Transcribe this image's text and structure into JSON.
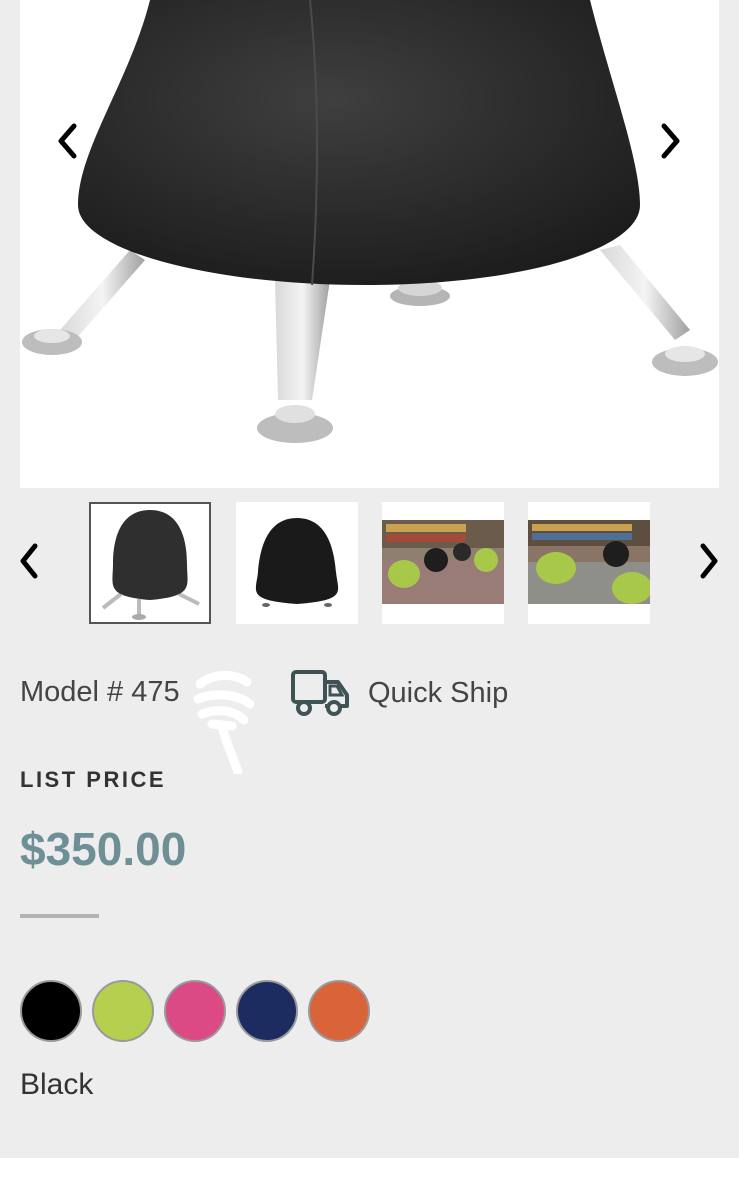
{
  "gallery": {
    "main_image": "black ball chair with silver legs",
    "prev_icon": "chevron-left-icon",
    "next_icon": "chevron-right-icon"
  },
  "thumbnails": {
    "items": [
      {
        "image": "black ball chair with legs",
        "selected": true
      },
      {
        "image": "black ball chair dome",
        "selected": false
      },
      {
        "image": "green and black ball chairs in library",
        "selected": false
      },
      {
        "image": "green ball chairs in library closeup",
        "selected": false
      }
    ]
  },
  "product": {
    "model_label": "Model # 475",
    "quick_ship_label": "Quick Ship",
    "quick_ship_icon": "delivery-truck-icon",
    "list_price_label": "LIST PRICE",
    "price": "$350.00",
    "price_color": "#6f8f96"
  },
  "colors": {
    "swatches": [
      {
        "name": "Black",
        "hex": "#000000"
      },
      {
        "name": "Lime",
        "hex": "#b5cf4f"
      },
      {
        "name": "Pink",
        "hex": "#dc4a85"
      },
      {
        "name": "Navy",
        "hex": "#1c2c60"
      },
      {
        "name": "Orange",
        "hex": "#d9643a"
      }
    ],
    "selected_name": "Black"
  }
}
